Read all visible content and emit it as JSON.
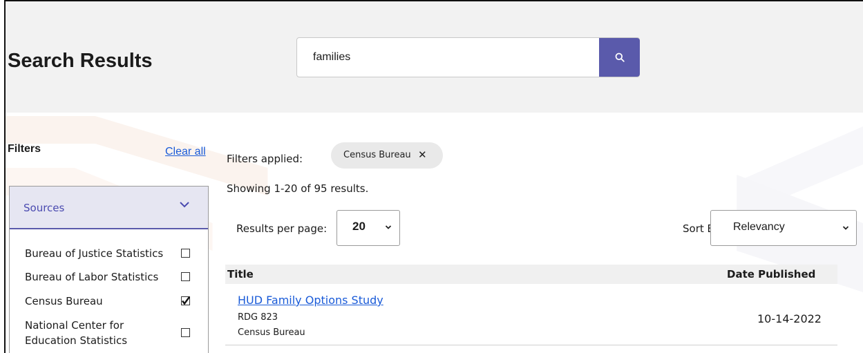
{
  "page": {
    "title": "Search Results"
  },
  "search": {
    "value": "families",
    "button_icon": "search-icon"
  },
  "filters": {
    "title": "Filters",
    "clear_all": "Clear all",
    "sources": {
      "label": "Sources",
      "expanded": true,
      "items": [
        {
          "label": "Bureau of Justice Statistics",
          "checked": false
        },
        {
          "label": "Bureau of Labor Statistics",
          "checked": false
        },
        {
          "label": "Census Bureau",
          "checked": true
        },
        {
          "label_line1": "National Center for",
          "label_line2": "Education Statistics",
          "checked": false
        }
      ]
    }
  },
  "results": {
    "filters_applied_label": "Filters applied:",
    "applied_chip": "Census Bureau",
    "chip_remove": "✕",
    "showing": "Showing 1-20 of 95 results.",
    "per_page_label": "Results per page:",
    "per_page_value": "20",
    "sort_label": "Sort By:",
    "sort_value": "Relevancy",
    "columns": {
      "title": "Title",
      "date": "Date Published"
    },
    "rows": [
      {
        "title": "HUD Family Options Study",
        "id": "RDG 823",
        "source": "Census Bureau",
        "date": "10-14-2022"
      }
    ]
  },
  "colors": {
    "accent": "#5a5aab",
    "link": "#1a5bd8",
    "header_bg": "#f2f2f2"
  }
}
